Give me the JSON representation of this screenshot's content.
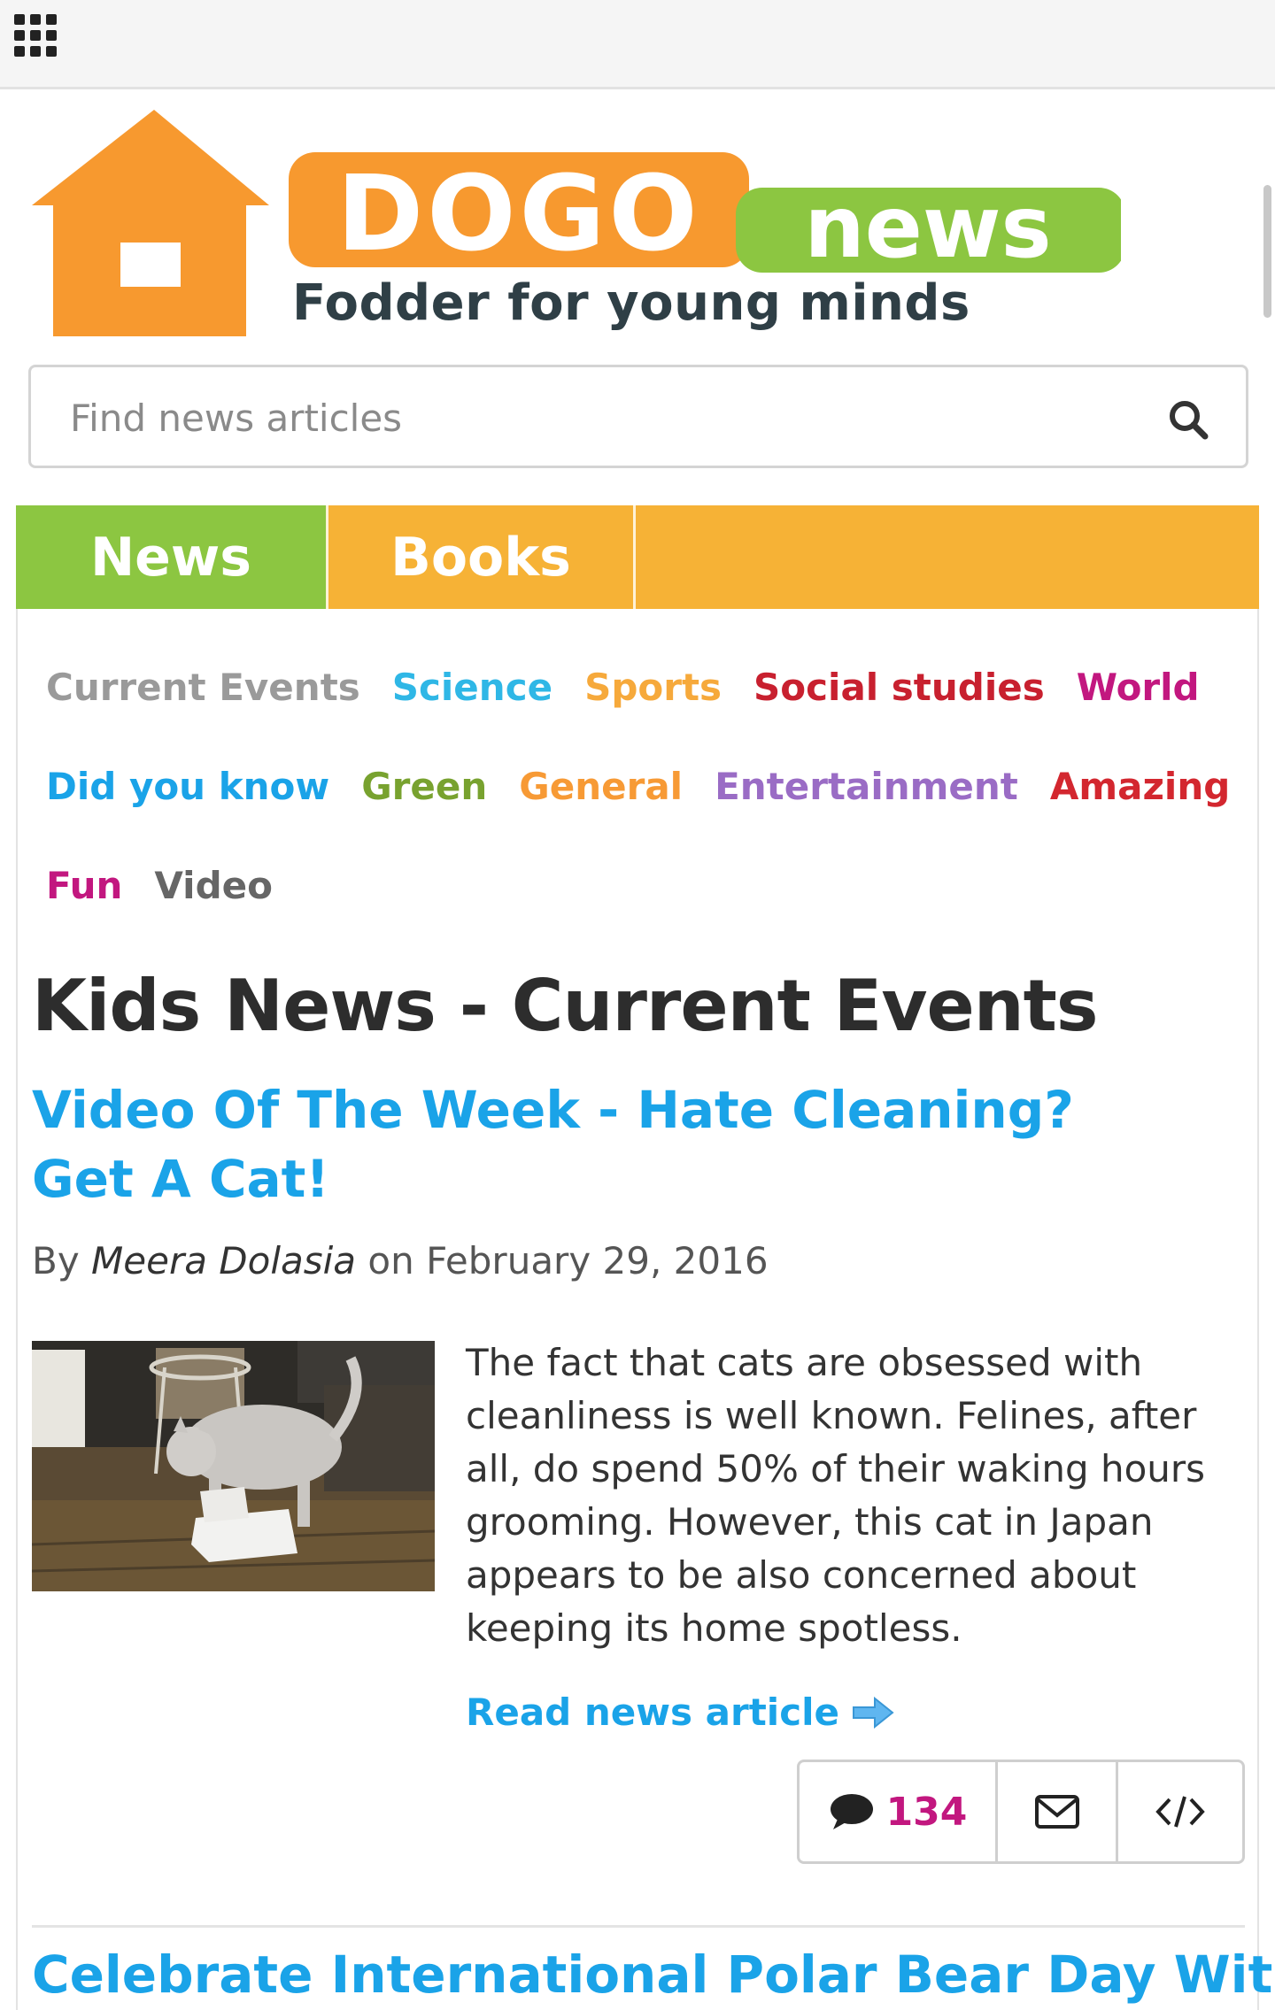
{
  "topbar": {
    "menu_icon": "apps-grid-icon"
  },
  "logo": {
    "brand_dogo": "DOGO",
    "brand_news": "news",
    "tagline": "Fodder for young minds",
    "colors": {
      "orange": "#f7992f",
      "green": "#8cc641"
    }
  },
  "search": {
    "placeholder": "Find news articles",
    "value": "",
    "icon": "search-icon"
  },
  "tabs": [
    {
      "label": "News",
      "color": "#8cc641"
    },
    {
      "label": "Books",
      "color": "#f6b236"
    }
  ],
  "categories": [
    {
      "label": "Current Events",
      "color": "#9a9a9a"
    },
    {
      "label": "Science",
      "color": "#2fb7e6"
    },
    {
      "label": "Sports",
      "color": "#f6a93b"
    },
    {
      "label": "Social studies",
      "color": "#c8202f"
    },
    {
      "label": "World",
      "color": "#c2177f"
    },
    {
      "label": "Did you know",
      "color": "#1aa3e8"
    },
    {
      "label": "Green",
      "color": "#78a22f"
    },
    {
      "label": "General",
      "color": "#f79a35"
    },
    {
      "label": "Entertainment",
      "color": "#9a6cc5"
    },
    {
      "label": "Amazing",
      "color": "#d3272f"
    },
    {
      "label": "Fun",
      "color": "#c2177f"
    },
    {
      "label": "Video",
      "color": "#666666"
    }
  ],
  "page": {
    "title": "Kids News - Current Events"
  },
  "article": {
    "title": "Video Of The Week - Hate Cleaning? Get A Cat!",
    "by": "By",
    "author": "Meera Dolasia",
    "on": "on February 29, 2016",
    "excerpt": "The fact that cats are obsessed with cleanliness is well known. Felines, after all, do spend 50% of their waking hours grooming. However, this cat in Japan appears to be also concerned about keeping its home spotless.",
    "read_more": "Read news article",
    "comments": "134"
  },
  "next_article": {
    "title": "Celebrate International Polar Bear Day With"
  }
}
